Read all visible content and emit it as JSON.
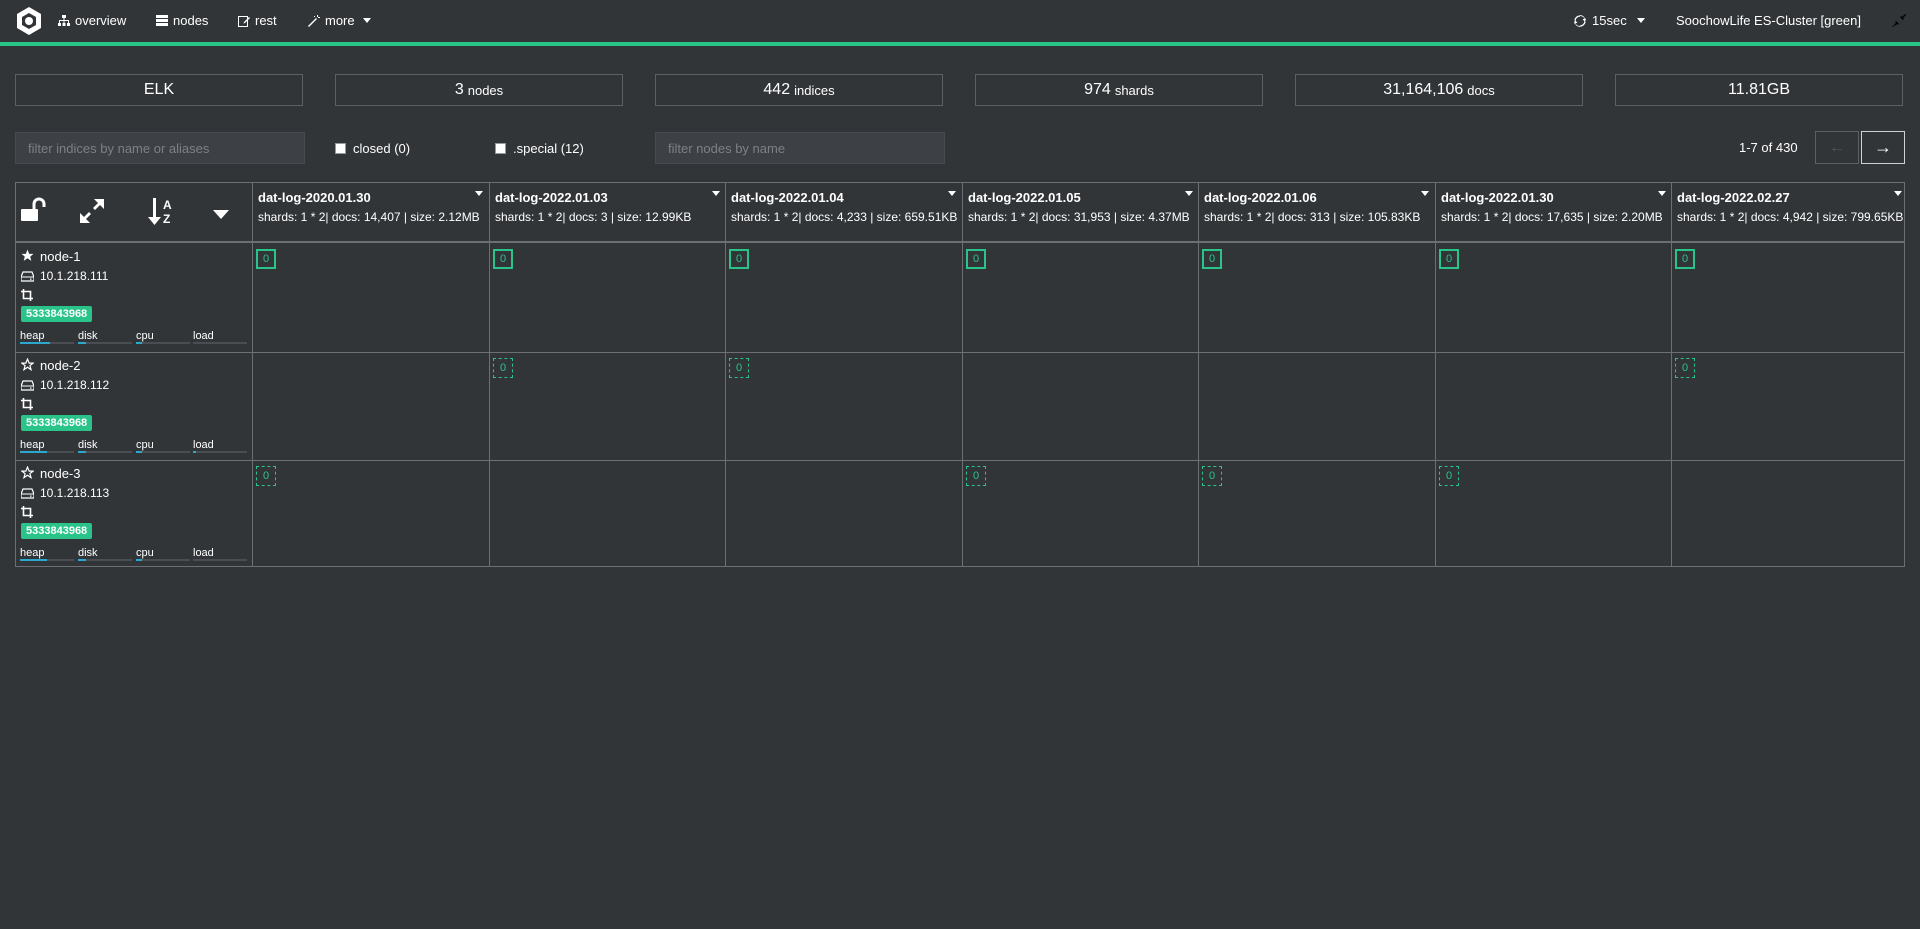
{
  "nav": {
    "items": [
      {
        "label": "overview",
        "icon": "sitemap-icon"
      },
      {
        "label": "nodes",
        "icon": "server-icon"
      },
      {
        "label": "rest",
        "icon": "edit-icon"
      },
      {
        "label": "more",
        "icon": "magic-wand-icon"
      }
    ],
    "refresh_label": "15sec",
    "cluster_label": "SoochowLife ES-Cluster [green]",
    "accent_color": "#2ac38a"
  },
  "stats": [
    {
      "num": "ELK",
      "lbl": ""
    },
    {
      "num": "3",
      "lbl": "nodes"
    },
    {
      "num": "442",
      "lbl": "indices"
    },
    {
      "num": "974",
      "lbl": "shards"
    },
    {
      "num": "31,164,106",
      "lbl": "docs"
    },
    {
      "num": "11.81GB",
      "lbl": ""
    }
  ],
  "filters": {
    "indices_placeholder": "filter indices by name or aliases",
    "closed_label": "closed (0)",
    "special_label": ".special (12)",
    "nodes_placeholder": "filter nodes by name"
  },
  "pager": {
    "text": "1-7 of 430",
    "prev": "←",
    "next": "→"
  },
  "indices": [
    {
      "name": "dat-log-2020.01.30",
      "info": "shards: 1 * 2| docs: 14,407 | size: 2.12MB"
    },
    {
      "name": "dat-log-2022.01.03",
      "info": "shards: 1 * 2| docs: 3 | size: 12.99KB"
    },
    {
      "name": "dat-log-2022.01.04",
      "info": "shards: 1 * 2| docs: 4,233 | size: 659.51KB"
    },
    {
      "name": "dat-log-2022.01.05",
      "info": "shards: 1 * 2| docs: 31,953 | size: 4.37MB"
    },
    {
      "name": "dat-log-2022.01.06",
      "info": "shards: 1 * 2| docs: 313 | size: 105.83KB"
    },
    {
      "name": "dat-log-2022.01.30",
      "info": "shards: 1 * 2| docs: 17,635 | size: 2.20MB"
    },
    {
      "name": "dat-log-2022.02.27",
      "info": "shards: 1 * 2| docs: 4,942 | size: 799.65KB"
    }
  ],
  "nodes": [
    {
      "name": "node-1",
      "ip": "10.1.218.111",
      "badge": "5333843968",
      "master": true,
      "metrics": [
        {
          "label": "heap",
          "value": 0.55
        },
        {
          "label": "disk",
          "value": 0.15
        },
        {
          "label": "cpu",
          "value": 0.12
        },
        {
          "label": "load",
          "value": 0.0
        }
      ]
    },
    {
      "name": "node-2",
      "ip": "10.1.218.112",
      "badge": "5333843968",
      "master": false,
      "metrics": [
        {
          "label": "heap",
          "value": 0.5
        },
        {
          "label": "disk",
          "value": 0.15
        },
        {
          "label": "cpu",
          "value": 0.12
        },
        {
          "label": "load",
          "value": 0.05
        }
      ]
    },
    {
      "name": "node-3",
      "ip": "10.1.218.113",
      "badge": "5333843968",
      "master": false,
      "metrics": [
        {
          "label": "heap",
          "value": 0.5
        },
        {
          "label": "disk",
          "value": 0.15
        },
        {
          "label": "cpu",
          "value": 0.12
        },
        {
          "label": "load",
          "value": 0.0
        }
      ]
    }
  ],
  "shards": [
    [
      "primary",
      "primary",
      "primary",
      "primary",
      "primary",
      "primary",
      "primary"
    ],
    [
      "",
      "replica",
      "replica",
      "",
      "",
      "",
      "replica"
    ],
    [
      "replica",
      "",
      "",
      "replica",
      "replica",
      "replica",
      ""
    ]
  ],
  "shard_label": "0",
  "toolbar_icons": [
    "unlock-icon",
    "expand-icon",
    "sort-alpha-icon",
    "caret-down-icon"
  ]
}
